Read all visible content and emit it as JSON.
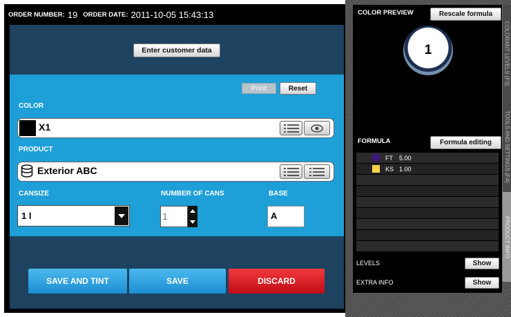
{
  "header": {
    "order_number_label": "ORDER NUMBER:",
    "order_number": "19",
    "order_date_label": "ORDER DATE:",
    "order_date": "2011-10-05 15:43:13"
  },
  "top": {
    "customer_button": "Enter customer data"
  },
  "form": {
    "print_button": "Print",
    "reset_button": "Reset",
    "color_label": "COLOR",
    "color_value": "X1",
    "color_swatch": "#000000",
    "product_label": "PRODUCT",
    "product_value": "Exterior ABC",
    "cansize_label": "CANSIZE",
    "cansize_value": "1 l",
    "cans_label": "NUMBER OF CANS",
    "cans_value": "1",
    "base_label": "BASE",
    "base_value": "A"
  },
  "actions": {
    "save_and_tint": "SAVE AND TINT",
    "save": "SAVE",
    "discard": "DISCARD"
  },
  "right": {
    "preview_title": "COLOR PREVIEW",
    "rescale_button": "Rescale formula",
    "formula_title": "FORMULA",
    "formula_edit_button": "Formula editing",
    "formula_rows": [
      {
        "code": "FT",
        "amount": "5.00",
        "color": "#3d1a7a"
      },
      {
        "code": "KS",
        "amount": "1.00",
        "color": "#f7d24a"
      }
    ],
    "levels_label": "LEVELS",
    "levels_button": "Show",
    "extra_label": "EXTRA INFO",
    "extra_button": "Show"
  },
  "side_tabs": {
    "tab1": "COLORANT LEVELS (F3)",
    "tab2": "TOOLS AND SETTINGS (F4)",
    "tab3": "PRODUCT INFO"
  },
  "callout": {
    "number": "1"
  },
  "icons": {
    "list": "list-icon",
    "eye": "eye-icon",
    "can": "paint-can-icon",
    "dropdown": "chevron-down-icon",
    "stepper": "stepper-arrows-icon"
  },
  "colors": {
    "form_blue": "#1e9fd8",
    "dark_blue": "#1d4360",
    "save_and_tint": "#2aa3e2",
    "save": "#2aa3e2",
    "discard": "#d8101a"
  }
}
